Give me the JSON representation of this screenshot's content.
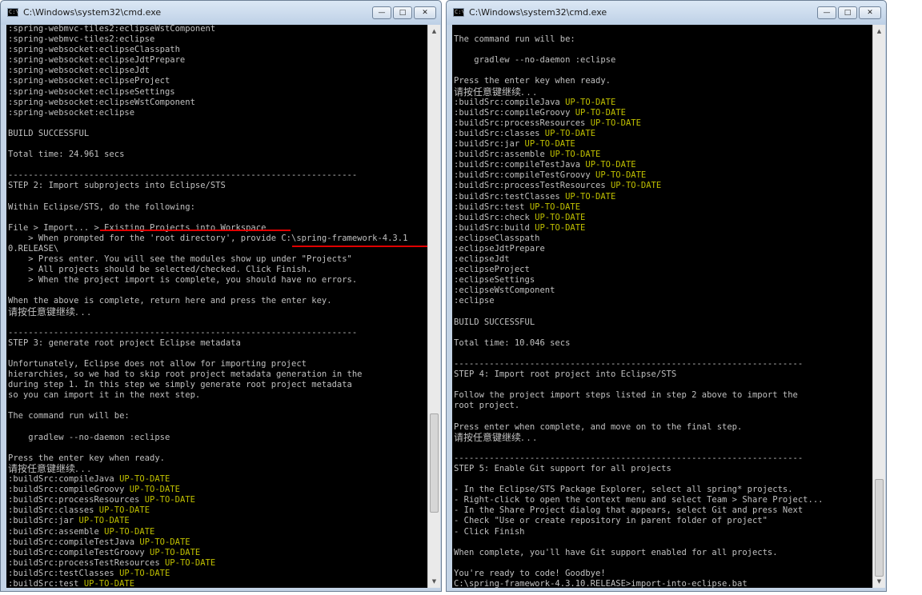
{
  "left_window": {
    "title": "C:\\Windows\\system32\\cmd.exe",
    "buttons": {
      "minimize": "—",
      "maximize": "□",
      "close": "✕"
    },
    "lines": [
      ":spring-webmvc-tiles2:eclipseWstComponent",
      ":spring-webmvc-tiles2:eclipse",
      ":spring-websocket:eclipseClasspath",
      ":spring-websocket:eclipseJdtPrepare",
      ":spring-websocket:eclipseJdt",
      ":spring-websocket:eclipseProject",
      ":spring-websocket:eclipseSettings",
      ":spring-websocket:eclipseWstComponent",
      ":spring-websocket:eclipse",
      "",
      "BUILD SUCCESSFUL",
      "",
      "Total time: 24.961 secs",
      "",
      "---------------------------------------------------------------------",
      "STEP 2: Import subprojects into Eclipse/STS",
      "",
      "Within Eclipse/STS, do the following:",
      "",
      "File > Import... > Existing Projects into Workspace",
      "    > When prompted for the 'root directory', provide C:\\spring-framework-4.3.1",
      "0.RELEASE\\",
      "    > Press enter. You will see the modules show up under \"Projects\"",
      "    > All projects should be selected/checked. Click Finish.",
      "    > When the project import is complete, you should have no errors.",
      "",
      "When the above is complete, return here and press the enter key.",
      "请按任意键继续. . .",
      "",
      "---------------------------------------------------------------------",
      "STEP 3: generate root project Eclipse metadata",
      "",
      "Unfortunately, Eclipse does not allow for importing project",
      "hierarchies, so we had to skip root project metadata generation in the",
      "during step 1. In this step we simply generate root project metadata",
      "so you can import it in the next step.",
      "",
      "The command run will be:",
      "",
      "    gradlew --no-daemon :eclipse",
      "",
      "Press the enter key when ready.",
      "请按任意键继续. . .",
      ":buildSrc:compileJava",
      ":buildSrc:compileGroovy",
      ":buildSrc:processResources",
      ":buildSrc:classes",
      ":buildSrc:jar",
      ":buildSrc:assemble",
      ":buildSrc:compileTestJava",
      ":buildSrc:compileTestGroovy",
      ":buildSrc:processTestResources",
      ":buildSrc:testClasses",
      ":buildSrc:test"
    ],
    "suffixes": {
      "43": "UP-TO-DATE",
      "44": "UP-TO-DATE",
      "45": "UP-TO-DATE",
      "46": "UP-TO-DATE",
      "47": "UP-TO-DATE",
      "48": "UP-TO-DATE",
      "49": "UP-TO-DATE",
      "50": "UP-TO-DATE",
      "51": "UP-TO-DATE",
      "52": "UP-TO-DATE",
      "53": "UP-TO-DATE"
    }
  },
  "right_window": {
    "title": "C:\\Windows\\system32\\cmd.exe",
    "buttons": {
      "minimize": "—",
      "maximize": "□",
      "close": "✕"
    },
    "lines": [
      "",
      "The command run will be:",
      "",
      "    gradlew --no-daemon :eclipse",
      "",
      "Press the enter key when ready.",
      "请按任意键继续. . .",
      ":buildSrc:compileJava",
      ":buildSrc:compileGroovy",
      ":buildSrc:processResources",
      ":buildSrc:classes",
      ":buildSrc:jar",
      ":buildSrc:assemble",
      ":buildSrc:compileTestJava",
      ":buildSrc:compileTestGroovy",
      ":buildSrc:processTestResources",
      ":buildSrc:testClasses",
      ":buildSrc:test",
      ":buildSrc:check",
      ":buildSrc:build",
      ":eclipseClasspath",
      ":eclipseJdtPrepare",
      ":eclipseJdt",
      ":eclipseProject",
      ":eclipseSettings",
      ":eclipseWstComponent",
      ":eclipse",
      "",
      "BUILD SUCCESSFUL",
      "",
      "Total time: 10.046 secs",
      "",
      "---------------------------------------------------------------------",
      "STEP 4: Import root project into Eclipse/STS",
      "",
      "Follow the project import steps listed in step 2 above to import the",
      "root project.",
      "",
      "Press enter when complete, and move on to the final step.",
      "请按任意键继续. . .",
      "",
      "---------------------------------------------------------------------",
      "STEP 5: Enable Git support for all projects",
      "",
      "- In the Eclipse/STS Package Explorer, select all spring* projects.",
      "- Right-click to open the context menu and select Team > Share Project...",
      "- In the Share Project dialog that appears, select Git and press Next",
      "- Check \"Use or create repository in parent folder of project\"",
      "- Click Finish",
      "",
      "When complete, you'll have Git support enabled for all projects.",
      "",
      "You're ready to code! Goodbye!",
      "C:\\spring-framework-4.3.10.RELEASE>import-into-eclipse.bat"
    ],
    "suffixes": {
      "7": "UP-TO-DATE",
      "8": "UP-TO-DATE",
      "9": "UP-TO-DATE",
      "10": "UP-TO-DATE",
      "11": "UP-TO-DATE",
      "12": "UP-TO-DATE",
      "13": "UP-TO-DATE",
      "14": "UP-TO-DATE",
      "15": "UP-TO-DATE",
      "16": "UP-TO-DATE",
      "17": "UP-TO-DATE",
      "18": "UP-TO-DATE",
      "19": "UP-TO-DATE"
    }
  },
  "colors": {
    "console_bg": "#000000",
    "console_text": "#c0c0c0",
    "up_to_date": "#c0c000",
    "annotation": "#e00000"
  }
}
